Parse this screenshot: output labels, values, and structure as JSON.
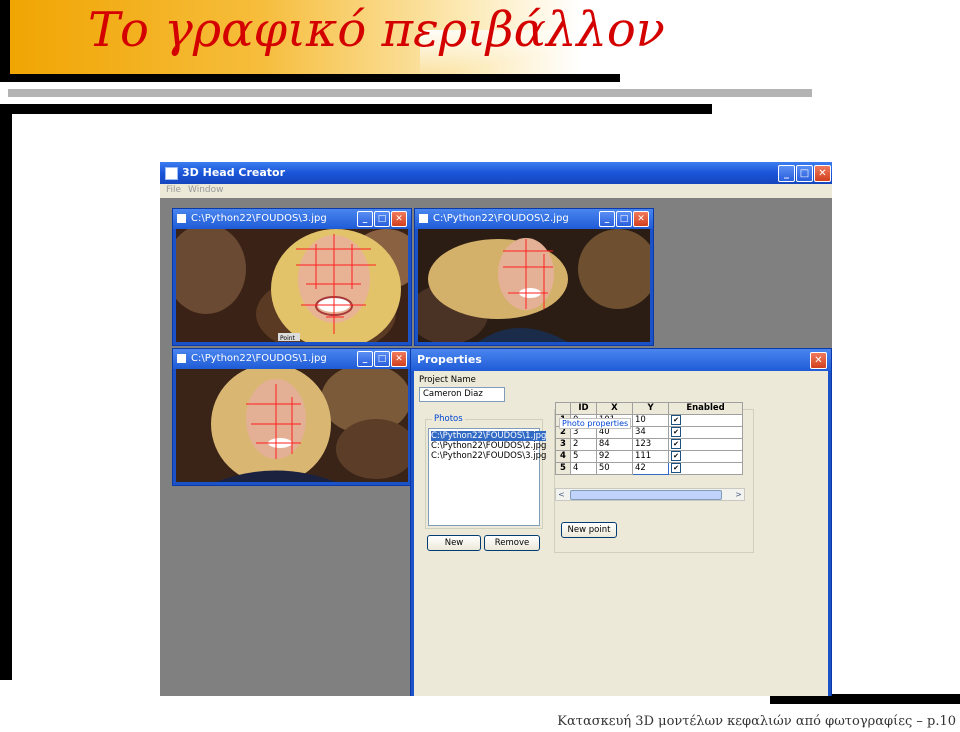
{
  "slide": {
    "title": "Το γραφικό περιβάλλον",
    "footer": "Κατασκευή 3D μοντέλων κεφαλιών από φωτογραφίες – p.10"
  },
  "app": {
    "title": "3D Head Creator",
    "menu": [
      "File",
      "Window"
    ],
    "controls": {
      "minimize": "_",
      "maximize": "□",
      "close": "✕"
    }
  },
  "children": [
    {
      "title": "C:\\Python22\\FOUDOS\\3.jpg",
      "caption": "Point"
    },
    {
      "title": "C:\\Python22\\FOUDOS\\2.jpg"
    },
    {
      "title": "C:\\Python22\\FOUDOS\\1.jpg"
    }
  ],
  "properties": {
    "title": "Properties",
    "project_name_label": "Project Name",
    "project_name_value": "Cameron Diaz",
    "photos_label": "Photos",
    "photos": [
      "C:\\Python22\\FOUDOS\\1.jpg",
      "C:\\Python22\\FOUDOS\\2.jpg",
      "C:\\Python22\\FOUDOS\\3.jpg"
    ],
    "selected_photo_index": 0,
    "new_button": "New",
    "remove_button": "Remove",
    "photo_properties_label": "Photo properties",
    "new_point_button": "New point",
    "grid": {
      "columns": [
        "ID",
        "X",
        "Y",
        "Enabled"
      ],
      "rows": [
        {
          "row": "1",
          "id": "0",
          "x": "101",
          "y": "10",
          "enabled": true
        },
        {
          "row": "2",
          "id": "3",
          "x": "40",
          "y": "34",
          "enabled": true
        },
        {
          "row": "3",
          "id": "2",
          "x": "84",
          "y": "123",
          "enabled": true
        },
        {
          "row": "4",
          "id": "5",
          "x": "92",
          "y": "111",
          "enabled": true
        },
        {
          "row": "5",
          "id": "4",
          "x": "50",
          "y": "42",
          "enabled": true
        }
      ]
    },
    "scroll_left": "<",
    "scroll_right": ">"
  }
}
